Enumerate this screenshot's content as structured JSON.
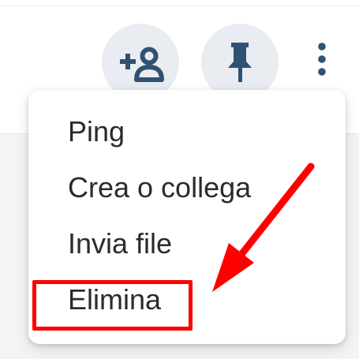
{
  "toolbar": {
    "add_user_icon": "add-user-icon",
    "pin_icon": "pin-icon",
    "more_icon": "kebab-menu-icon"
  },
  "menu": {
    "items": [
      {
        "label": "Ping"
      },
      {
        "label": "Crea o collega"
      },
      {
        "label": "Invia file"
      },
      {
        "label": "Elimina"
      }
    ]
  },
  "annotation": {
    "highlight_color": "#ff0000",
    "arrow_color": "#ff0000"
  },
  "colors": {
    "icon": "#2f5274",
    "button_bg": "#e9ecf0",
    "text": "#2b2b2b"
  }
}
